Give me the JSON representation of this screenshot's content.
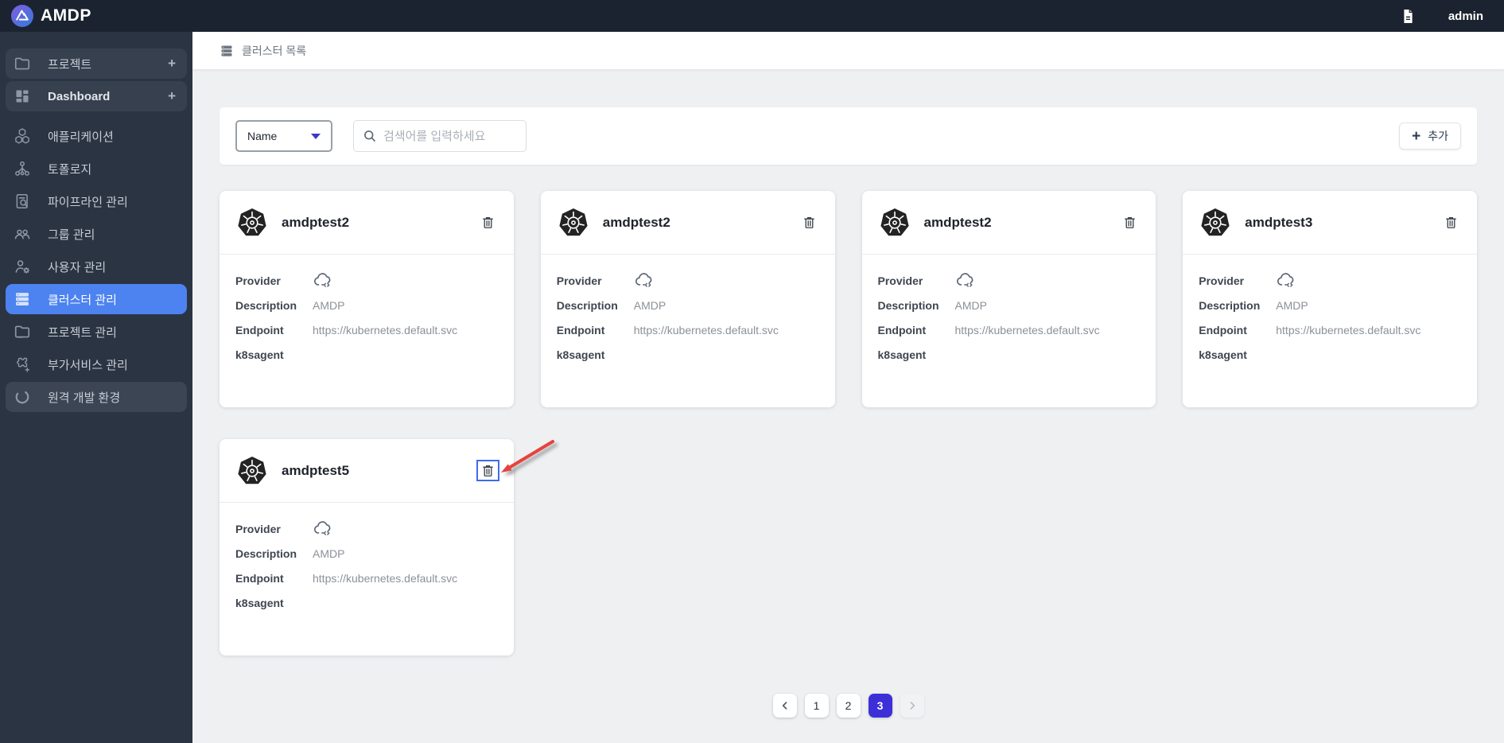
{
  "topbar": {
    "brand": "AMDP",
    "user": "admin"
  },
  "sidebar": {
    "items": [
      {
        "label": "프로젝트",
        "suffix": "+"
      },
      {
        "label": "Dashboard",
        "suffix": "+"
      },
      {
        "label": "애플리케이션"
      },
      {
        "label": "토폴로지"
      },
      {
        "label": "파이프라인 관리"
      },
      {
        "label": "그룹 관리"
      },
      {
        "label": "사용자 관리"
      },
      {
        "label": "클러스터 관리"
      },
      {
        "label": "프로젝트 관리"
      },
      {
        "label": "부가서비스 관리"
      },
      {
        "label": "원격 개발 환경"
      }
    ]
  },
  "breadcrumb": {
    "label": "클러스터 목록"
  },
  "toolbar": {
    "filter_value": "Name",
    "search_placeholder": "검색어를 입력하세요",
    "add_plus": "+",
    "add_label": "추가"
  },
  "card_labels": {
    "provider": "Provider",
    "description": "Description",
    "endpoint": "Endpoint",
    "k8sagent": "k8sagent"
  },
  "cards": [
    {
      "name": "amdptest2",
      "description": "AMDP",
      "endpoint": "https://kubernetes.default.svc",
      "k8sagent": ""
    },
    {
      "name": "amdptest2",
      "description": "AMDP",
      "endpoint": "https://kubernetes.default.svc",
      "k8sagent": ""
    },
    {
      "name": "amdptest2",
      "description": "AMDP",
      "endpoint": "https://kubernetes.default.svc",
      "k8sagent": ""
    },
    {
      "name": "amdptest3",
      "description": "AMDP",
      "endpoint": "https://kubernetes.default.svc",
      "k8sagent": ""
    },
    {
      "name": "amdptest5",
      "description": "AMDP",
      "endpoint": "https://kubernetes.default.svc",
      "k8sagent": ""
    }
  ],
  "pagination": {
    "pages": [
      "1",
      "2",
      "3"
    ],
    "active_page": "3"
  },
  "colors": {
    "topbar_bg": "#1b2330",
    "sidebar_bg": "#2b3443",
    "sidebar_active": "#4d83f0",
    "pagination_active": "#3c2fd8",
    "annotation_arrow": "#e8423c"
  }
}
